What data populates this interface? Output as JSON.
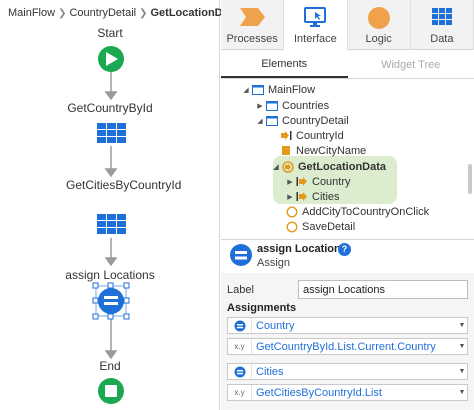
{
  "breadcrumb": [
    "MainFlow",
    "CountryDetail",
    "GetLocationData"
  ],
  "flow": {
    "nodes": [
      "Start",
      "GetCountryById",
      "GetCitiesByCountryId",
      "assign Locations",
      "End"
    ]
  },
  "tabs": [
    {
      "label": "Processes",
      "icon": "chevron-flag-icon"
    },
    {
      "label": "Interface",
      "icon": "monitor-icon",
      "active": true
    },
    {
      "label": "Logic",
      "icon": "orange-circle-icon"
    },
    {
      "label": "Data",
      "icon": "grid-icon"
    }
  ],
  "subtabs": [
    {
      "label": "Elements",
      "active": true
    },
    {
      "label": "Widget Tree"
    }
  ],
  "tree": [
    {
      "label": "MainFlow",
      "icon": "flow-screen-icon",
      "twisty": "down"
    },
    {
      "label": "Countries",
      "icon": "screen-icon",
      "twisty": "right"
    },
    {
      "label": "CountryDetail",
      "icon": "screen-icon",
      "twisty": "down"
    },
    {
      "label": "CountryId",
      "icon": "input-parameter-icon"
    },
    {
      "label": "NewCityName",
      "icon": "local-variable-icon"
    },
    {
      "label": "GetLocationData",
      "icon": "data-action-icon",
      "twisty": "down",
      "bold": true
    },
    {
      "label": "Country",
      "icon": "output-parameter-icon",
      "twisty": "right"
    },
    {
      "label": "Cities",
      "icon": "output-parameter-icon",
      "twisty": "right"
    },
    {
      "label": "AddCityToCountryOnClick",
      "icon": "client-action-icon"
    },
    {
      "label": "SaveDetail",
      "icon": "client-action-icon"
    }
  ],
  "props": {
    "title": "assign Locations",
    "help": "?",
    "subtitle": "Assign",
    "label_caption": "Label",
    "label_value": "assign Locations",
    "assignments_caption": "Assignments",
    "assignments": [
      {
        "variable": "Country",
        "value": "GetCountryById.List.Current.Country",
        "value_icon": "x.y"
      },
      {
        "variable": "Cities",
        "value": "GetCitiesByCountryId.List",
        "value_icon": "x.y"
      }
    ]
  },
  "colors": {
    "start_green": "#1aa851",
    "end_green": "#1aa851",
    "aggregate_blue": "#1f6fd8",
    "assign_blue": "#1f6fd8",
    "highlight": "#dbeccf"
  }
}
